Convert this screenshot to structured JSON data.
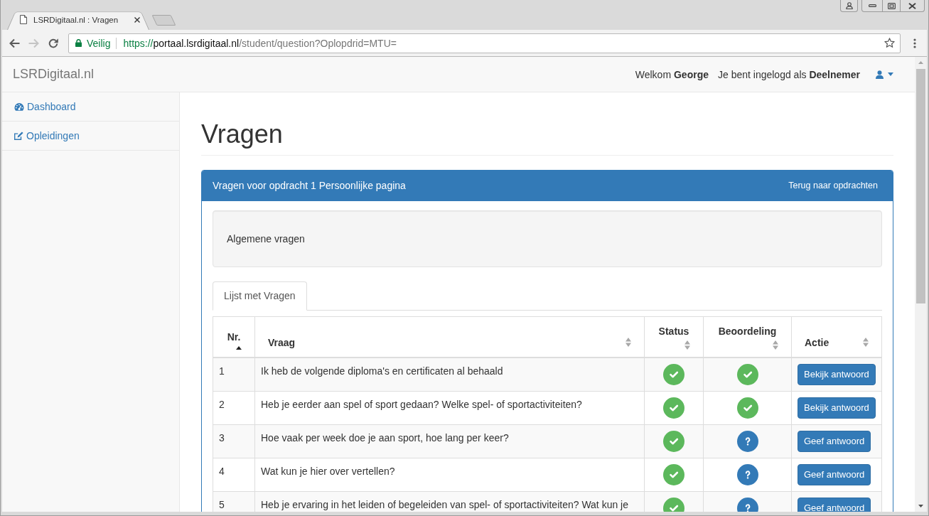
{
  "browser": {
    "tab_title": "LSRDigitaal.nl : Vragen",
    "navigation": [
      {
        "kind": "back",
        "disabled": false
      },
      {
        "kind": "forward",
        "disabled": true
      },
      {
        "kind": "reload",
        "disabled": false
      }
    ],
    "address_bar": {
      "security_label": "Veilig",
      "scheme": "https://",
      "host": "portaal.lsrdigitaal.nl",
      "path": "/student/question?Oplopdrid=MTU="
    }
  },
  "navbar": {
    "brand": "LSRDigitaal.nl",
    "welcome": "Welkom **George**",
    "role": "Je bent ingelogd als **Deelnemer**"
  },
  "sidebar": {
    "items": [
      {
        "label": "Dashboard",
        "kind": "dashboard"
      },
      {
        "label": "Opleidingen",
        "kind": "edit"
      }
    ]
  },
  "page": {
    "title": "Vragen"
  },
  "panel": {
    "title": "Vragen voor opdracht 1 Persoonlijke pagina",
    "back_link": "Terug naar opdrachten",
    "section": "Algemene vragen",
    "tabs": [
      {
        "label": "Lijst met Vragen",
        "selected": true
      }
    ],
    "table": {
      "columns": [
        {
          "label": "Nr.",
          "sorted": true
        },
        {
          "label": "Vraag",
          "sorted": false
        },
        {
          "label": "Status",
          "sorted": false
        },
        {
          "label": "Beoordeling",
          "sorted": false
        },
        {
          "label": "Actie",
          "sorted": false
        }
      ],
      "rows": [
        {
          "nr": "1",
          "question": "Ik heb de volgende diploma's en certificaten al behaald",
          "answered": true,
          "assessed": true,
          "action": "Bekijk antwoord"
        },
        {
          "nr": "2",
          "question": "Heb je eerder aan spel of sport gedaan? Welke spel- of sportactiviteiten?",
          "answered": true,
          "assessed": true,
          "action": "Bekijk antwoord"
        },
        {
          "nr": "3",
          "question": "Hoe vaak per week doe je aan sport, hoe lang per keer?",
          "answered": true,
          "assessed": false,
          "action": "Geef antwoord"
        },
        {
          "nr": "4",
          "question": "Wat kun je hier over vertellen?",
          "answered": true,
          "assessed": false,
          "action": "Geef antwoord"
        },
        {
          "nr": "5",
          "question": "Heb je ervaring in het leiden of begeleiden van spel- of sportactiviteiten? Wat kun je",
          "answered": true,
          "assessed": false,
          "action": "Geef antwoord"
        }
      ]
    }
  }
}
